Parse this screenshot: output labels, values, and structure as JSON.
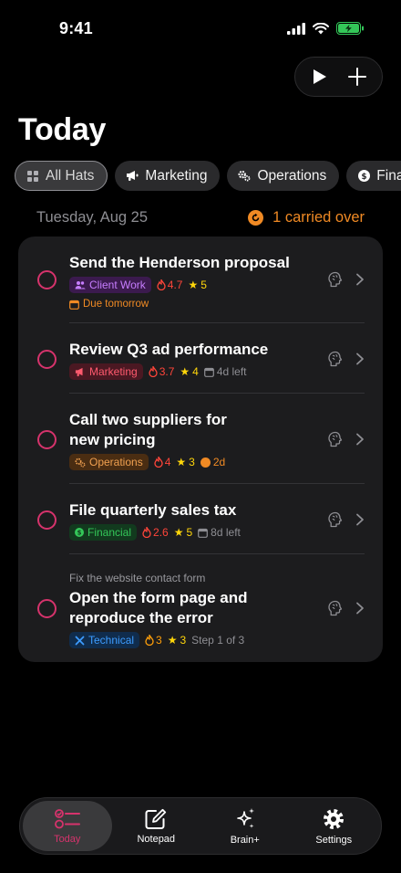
{
  "status_bar": {
    "time": "9:41"
  },
  "header": {
    "title": "Today"
  },
  "filters": [
    {
      "label": "All Hats",
      "icon": "grid-icon",
      "active": true
    },
    {
      "label": "Marketing",
      "icon": "megaphone-icon",
      "active": false
    },
    {
      "label": "Operations",
      "icon": "gears-icon",
      "active": false
    },
    {
      "label": "Fina",
      "icon": "dollar-icon",
      "active": false
    }
  ],
  "date_row": {
    "date": "Tuesday, Aug 25",
    "carried": "1 carried over"
  },
  "tasks": [
    {
      "title": "Send the Henderson proposal",
      "tag": "Client Work",
      "priority": "4.7",
      "stars": "5",
      "due": "Due tomorrow"
    },
    {
      "title": "Review Q3 ad performance",
      "tag": "Marketing",
      "priority": "3.7",
      "stars": "4",
      "extra": "4d left"
    },
    {
      "title_line1": "Call two suppliers for",
      "title_line2": "new pricing",
      "tag": "Operations",
      "priority": "4",
      "stars": "3",
      "extra": "2d"
    },
    {
      "title": "File quarterly sales tax",
      "tag": "Financial",
      "priority": "2.6",
      "stars": "5",
      "extra": "8d left"
    },
    {
      "parent": "Fix the website contact form",
      "title_line1": "Open the form page and",
      "title_line2": "reproduce the error",
      "tag": "Technical",
      "priority": "3",
      "stars": "3",
      "extra": "Step 1 of 3"
    }
  ],
  "tab_bar": [
    {
      "label": "Today",
      "icon": "checklist-icon",
      "active": true
    },
    {
      "label": "Notepad",
      "icon": "notepad-icon",
      "active": false
    },
    {
      "label": "Brain+",
      "icon": "sparkle-icon",
      "active": false
    },
    {
      "label": "Settings",
      "icon": "gear-icon",
      "active": false
    }
  ],
  "colors": {
    "accent": "#d6336c",
    "carried": "#f08a24",
    "card": "#1c1c1e",
    "background": "#000000"
  }
}
